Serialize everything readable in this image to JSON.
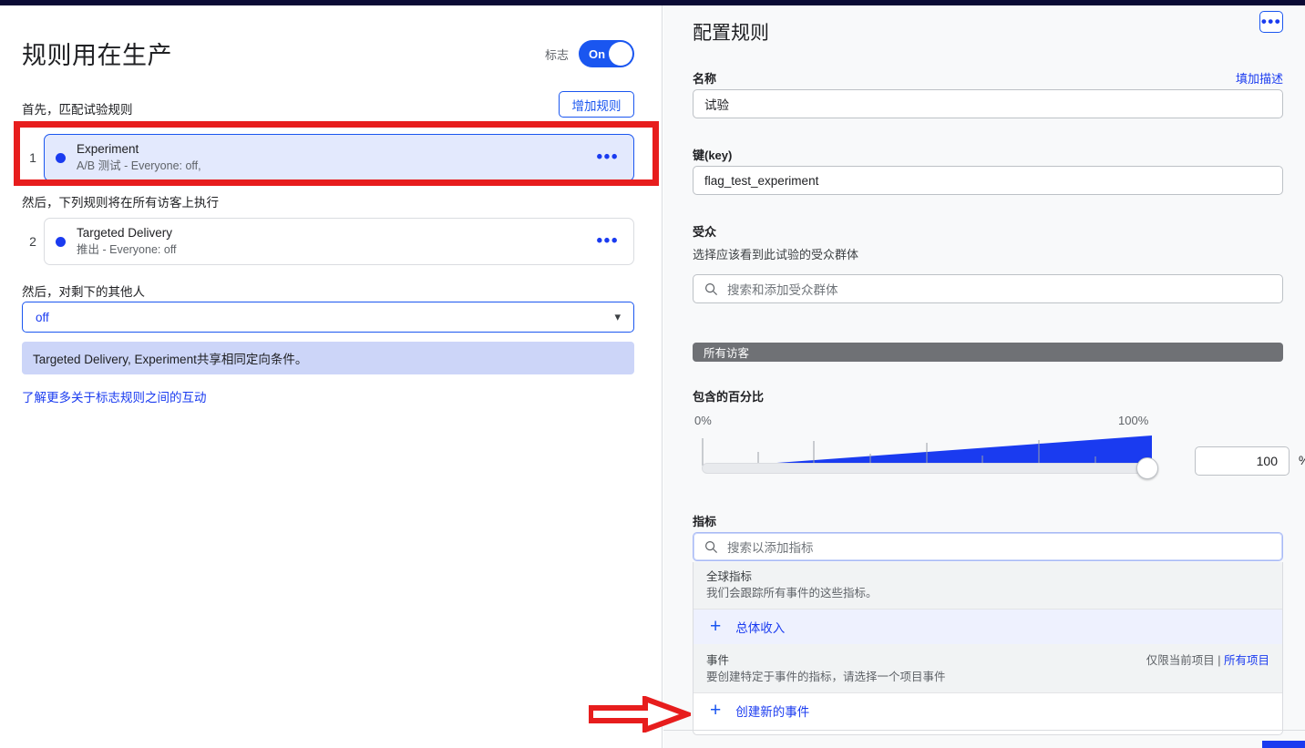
{
  "left": {
    "title": "规则用在生产",
    "flag_label": "标志",
    "toggle_state": "On",
    "first_label": "首先，匹配试验规则",
    "add_rule_button": "增加规则",
    "rules_first": [
      {
        "num": "1",
        "title": "Experiment",
        "subtitle": "A/B 测试 - Everyone: off,",
        "menu": "•••"
      }
    ],
    "then_label": "然后，下列规则将在所有访客上执行",
    "rules_then": [
      {
        "num": "2",
        "title": "Targeted Delivery",
        "subtitle": "推出 - Everyone: off",
        "menu": "•••"
      }
    ],
    "rest_label": "然后，对剩下的其他人",
    "default_value": "off",
    "info_banner": "Targeted Delivery, Experiment共享相同定向条件。",
    "learn_more": "了解更多关于标志规则之间的互动"
  },
  "right": {
    "title": "配置规则",
    "menu_button": "•••",
    "name_label": "名称",
    "add_description_link": "填加描述",
    "name_value": "试验",
    "key_label": "键(key)",
    "key_value": "flag_test_experiment",
    "audience_label": "受众",
    "audience_sub": "选择应该看到此试验的受众群体",
    "audience_placeholder": "搜索和添加受众群体",
    "all_visitors_bar": "所有访客",
    "percent_label": "包含的百分比",
    "metric_label": "指标",
    "metric_placeholder": "搜索以添加指标",
    "dropdown": {
      "global_group_title": "全球指标",
      "global_group_sub": "我们会跟踪所有事件的这些指标。",
      "global_items": [
        {
          "label": "总体收入",
          "icon": "plus-icon"
        }
      ],
      "events_group_title": "事件",
      "events_scope_current": "仅限当前项目",
      "events_scope_sep": "|",
      "events_scope_all": "所有项目",
      "events_group_sub": "要创建特定于事件的指标，请选择一个项目事件",
      "event_items": [
        {
          "label": "创建新的事件",
          "icon": "plus-icon"
        }
      ]
    }
  },
  "chart_data": {
    "type": "area",
    "title": "包含的百分比",
    "min_label": "0%",
    "max_label": "100%",
    "value": 100,
    "value_text": "100",
    "unit": "%",
    "xlim": [
      0,
      100
    ],
    "accent": "#1a3bf0"
  },
  "annotations": {
    "highlight_rect_color": "#e71d1d",
    "arrow_color": "#e71d1d"
  }
}
